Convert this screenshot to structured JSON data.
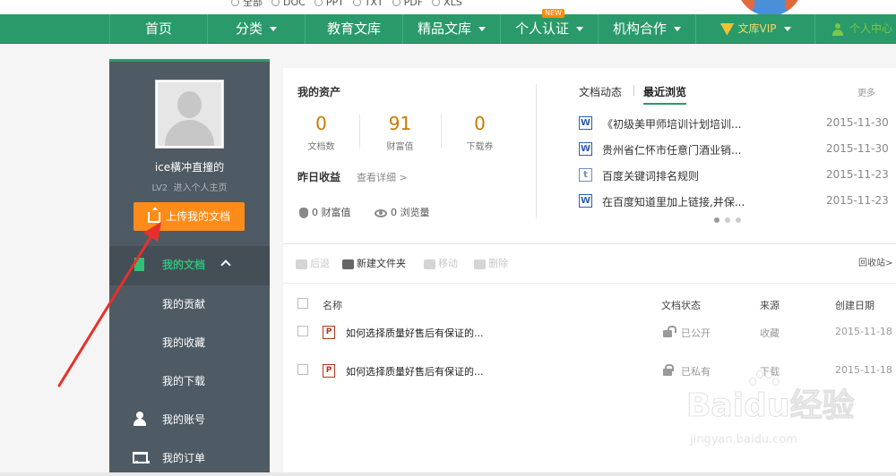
{
  "topbar": {
    "radio_labels": [
      "全部",
      "DOC",
      "PPT",
      "TXT",
      "PDF",
      "XLS"
    ]
  },
  "nav": {
    "items": [
      {
        "label": "首页"
      },
      {
        "label": "分类"
      },
      {
        "label": "教育文库"
      },
      {
        "label": "精品文库"
      },
      {
        "label": "个人认证",
        "badge": "NEW"
      },
      {
        "label": "机构合作"
      },
      {
        "label": "文库VIP"
      },
      {
        "label": "个人中心"
      }
    ],
    "accent": "#2a9a6a"
  },
  "sidebar": {
    "username": "ice橫冲直撞的",
    "level": "LV2",
    "level_link": "进入个人主页",
    "upload_label": "上传我的文档",
    "section_label": "我的文档",
    "sub_items": [
      "我的贡献",
      "我的收藏",
      "我的下载"
    ],
    "items": [
      {
        "label": "我的账号",
        "icon": "person-icon"
      },
      {
        "label": "我的订单",
        "icon": "cart-icon"
      }
    ]
  },
  "assets": {
    "title": "我的资产",
    "stats": [
      {
        "value": "0",
        "label": "文档数"
      },
      {
        "value": "91",
        "label": "财富值"
      },
      {
        "value": "0",
        "label": "下载券"
      }
    ],
    "income_title": "昨日收益",
    "income_link": "查看详细 >",
    "income_items": [
      {
        "value": "0",
        "label": "财富值"
      },
      {
        "value": "0",
        "label": "浏览量"
      }
    ]
  },
  "recent": {
    "tabs": [
      "文档动态",
      "最近浏览"
    ],
    "more": "更多",
    "items": [
      {
        "type": "W",
        "title": "《初级美甲师培训计划培训...",
        "date": "2015-11-30"
      },
      {
        "type": "W",
        "title": "贵州省仁怀市任意门酒业销...",
        "date": "2015-11-30"
      },
      {
        "type": "t",
        "title": "百度关键词排名规则",
        "date": "2015-11-23"
      },
      {
        "type": "W",
        "title": "在百度知道里加上链接,并保...",
        "date": "2015-11-23"
      }
    ]
  },
  "toolbar": {
    "back": "后退",
    "new_folder": "新建文件夹",
    "move": "移动",
    "delete": "删除",
    "recycle": "回收站>"
  },
  "table": {
    "headers": {
      "name": "名称",
      "status": "文档状态",
      "source": "来源",
      "date": "创建日期"
    },
    "rows": [
      {
        "type": "P",
        "name": "如何选择质量好售后有保证的...",
        "status": "已公开",
        "source": "收藏",
        "date": "2015-11-18"
      },
      {
        "type": "P",
        "name": "如何选择质量好售后有保证的...",
        "status": "已私有",
        "source": "下载",
        "date": "2015-11-18"
      }
    ]
  },
  "watermark": {
    "main": "Baidu经验",
    "sub": "jingyan.baidu.com"
  }
}
